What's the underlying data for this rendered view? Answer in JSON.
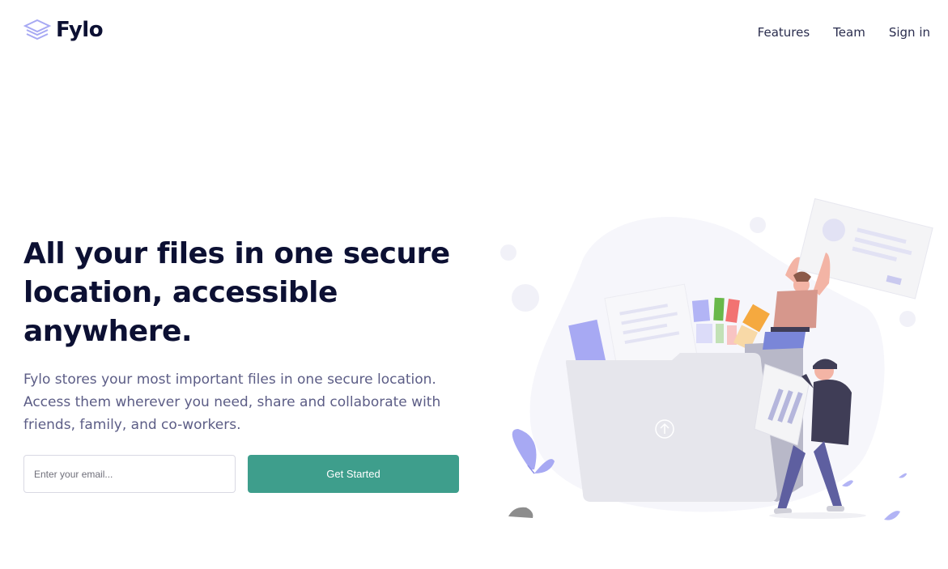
{
  "brand": {
    "name": "Fylo",
    "accent": "#a7a9f3",
    "text_color": "#0c1033"
  },
  "nav": {
    "items": [
      {
        "label": "Features"
      },
      {
        "label": "Team"
      },
      {
        "label": "Sign in"
      }
    ]
  },
  "hero": {
    "title": "All your files in one secure location, accessible anywhere.",
    "description": "Fylo stores your most important files in one secure location. Access them wherever you need, share and collaborate with friends, family, and co-workers.",
    "email_placeholder": "Enter your email...",
    "cta_label": "Get Started",
    "cta_color": "#3e9e8c"
  },
  "illustration": {
    "icon": "file-upload-illustration"
  }
}
